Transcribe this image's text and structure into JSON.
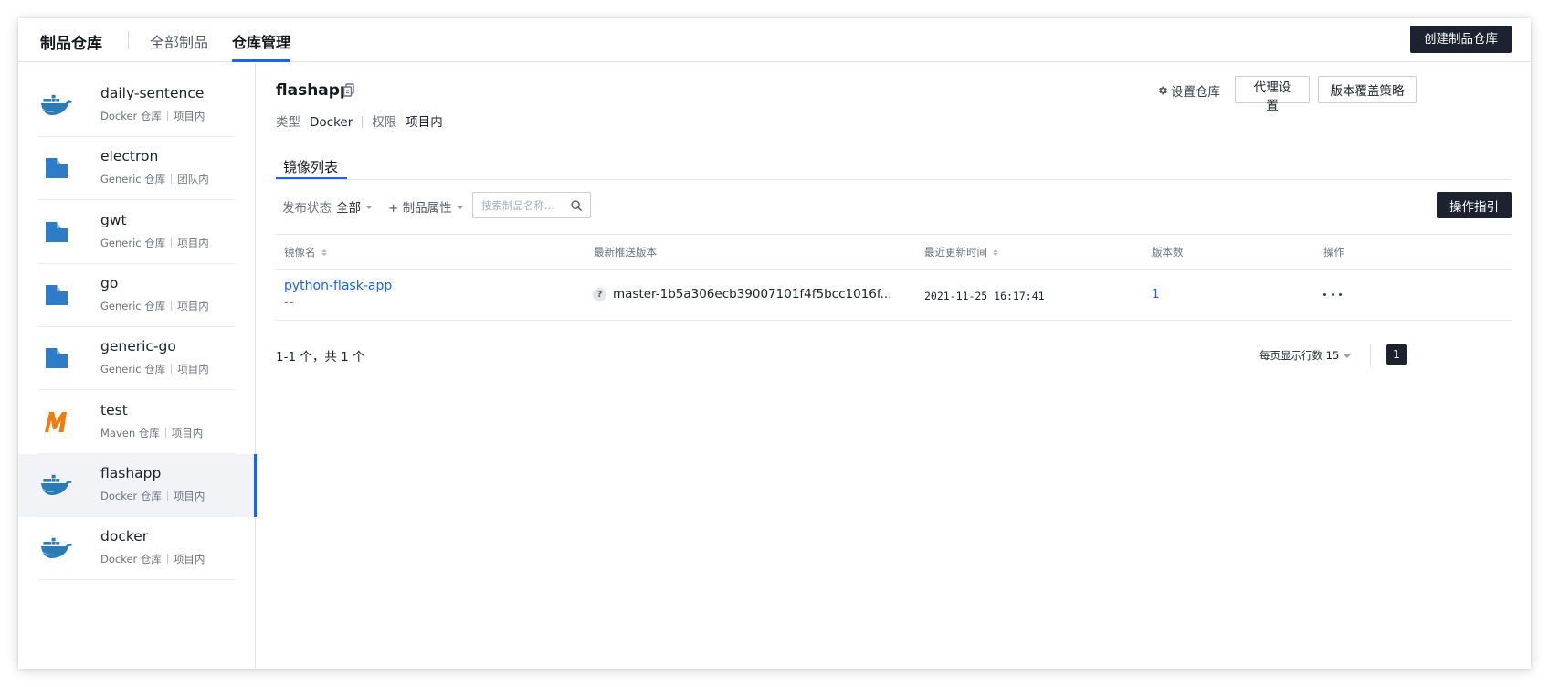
{
  "header": {
    "app_title": "制品仓库",
    "tabs": [
      "全部制品",
      "仓库管理"
    ],
    "active_tab": "仓库管理",
    "create_button": "创建制品仓库"
  },
  "sidebar": {
    "items": [
      {
        "name": "daily-sentence",
        "type": "Docker 仓库",
        "scope": "项目内",
        "icon": "docker-icon",
        "active": false
      },
      {
        "name": "electron",
        "type": "Generic 仓库",
        "scope": "团队内",
        "icon": "generic-icon",
        "active": false
      },
      {
        "name": "gwt",
        "type": "Generic 仓库",
        "scope": "项目内",
        "icon": "generic-icon",
        "active": false
      },
      {
        "name": "go",
        "type": "Generic 仓库",
        "scope": "项目内",
        "icon": "generic-icon",
        "active": false
      },
      {
        "name": "generic-go",
        "type": "Generic 仓库",
        "scope": "项目内",
        "icon": "generic-icon",
        "active": false
      },
      {
        "name": "test",
        "type": "Maven 仓库",
        "scope": "项目内",
        "icon": "maven-icon",
        "active": false
      },
      {
        "name": "flashapp",
        "type": "Docker 仓库",
        "scope": "项目内",
        "icon": "docker-icon",
        "active": true
      },
      {
        "name": "docker",
        "type": "Docker 仓库",
        "scope": "项目内",
        "icon": "docker-icon",
        "active": false
      }
    ]
  },
  "repo": {
    "name": "flashapp",
    "type_label": "类型",
    "type_value": "Docker",
    "permission_label": "权限",
    "permission_value": "项目内",
    "settings_link": "设置仓库",
    "proxy_button": "代理设置",
    "policy_button": "版本覆盖策略"
  },
  "subtab": "镜像列表",
  "filters": {
    "status_label": "发布状态",
    "status_value": "全部",
    "attr_label": "+ 制品属性",
    "search_placeholder": "搜索制品名称...",
    "guide_button": "操作指引"
  },
  "table": {
    "headers": {
      "name": "镜像名",
      "latest_version": "最新推送版本",
      "updated": "最近更新时间",
      "count": "版本数",
      "actions": "操作"
    },
    "rows": [
      {
        "name": "python-flask-app",
        "desc": "--",
        "latest_version": "master-1b5a306ecb39007101f4f5bcc1016f...",
        "updated": "2021-11-25 16:17:41",
        "count": "1"
      }
    ]
  },
  "pagination": {
    "total_text": "1-1 个，共 1 个",
    "page_size_label": "每页显示行数 15",
    "current_page": "1"
  },
  "colors": {
    "accent": "#1b62f0",
    "dark_button": "#1c2230",
    "docker_blue": "#2b7bb9",
    "maven_orange": "#f27b0e"
  }
}
